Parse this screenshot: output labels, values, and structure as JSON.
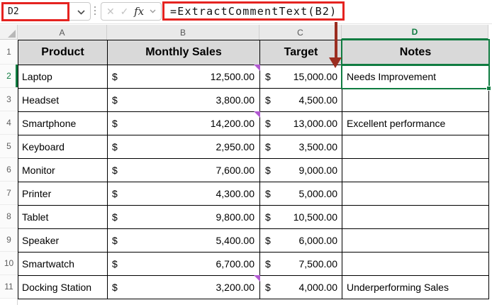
{
  "name_box": {
    "value": "D2"
  },
  "formula_bar": {
    "formula": "=ExtractCommentText(B2)",
    "cancel": "✕",
    "enter": "✓",
    "fx": "fx"
  },
  "grid": {
    "column_headers": [
      {
        "label": "A",
        "selected": false
      },
      {
        "label": "B",
        "selected": false
      },
      {
        "label": "C",
        "selected": false
      },
      {
        "label": "D",
        "selected": true
      }
    ],
    "row_headers": [
      {
        "label": "1",
        "selected": false
      },
      {
        "label": "2",
        "selected": true
      },
      {
        "label": "3",
        "selected": false
      },
      {
        "label": "4",
        "selected": false
      },
      {
        "label": "5",
        "selected": false
      },
      {
        "label": "6",
        "selected": false
      },
      {
        "label": "7",
        "selected": false
      },
      {
        "label": "8",
        "selected": false
      },
      {
        "label": "9",
        "selected": false
      },
      {
        "label": "10",
        "selected": false
      },
      {
        "label": "11",
        "selected": false
      }
    ]
  },
  "table": {
    "currency_symbol": "$",
    "columns": [
      "Product",
      "Monthly Sales",
      "Target",
      "Notes"
    ],
    "rows": [
      {
        "row": 2,
        "product": "Laptop",
        "sales": "12,500.00",
        "target": "15,000.00",
        "notes": "Needs Improvement",
        "has_comment": true,
        "selected": true
      },
      {
        "row": 3,
        "product": "Headset",
        "sales": "3,800.00",
        "target": "4,500.00",
        "notes": "",
        "has_comment": false,
        "selected": false
      },
      {
        "row": 4,
        "product": "Smartphone",
        "sales": "14,200.00",
        "target": "13,000.00",
        "notes": "Excellent performance",
        "has_comment": true,
        "selected": false
      },
      {
        "row": 5,
        "product": "Keyboard",
        "sales": "2,950.00",
        "target": "3,500.00",
        "notes": "",
        "has_comment": false,
        "selected": false
      },
      {
        "row": 6,
        "product": "Monitor",
        "sales": "7,600.00",
        "target": "9,000.00",
        "notes": "",
        "has_comment": false,
        "selected": false
      },
      {
        "row": 7,
        "product": "Printer",
        "sales": "4,300.00",
        "target": "5,000.00",
        "notes": "",
        "has_comment": false,
        "selected": false
      },
      {
        "row": 8,
        "product": "Tablet",
        "sales": "9,800.00",
        "target": "10,500.00",
        "notes": "",
        "has_comment": false,
        "selected": false
      },
      {
        "row": 9,
        "product": "Speaker",
        "sales": "5,400.00",
        "target": "6,000.00",
        "notes": "",
        "has_comment": false,
        "selected": false
      },
      {
        "row": 10,
        "product": "Smartwatch",
        "sales": "6,700.00",
        "target": "7,500.00",
        "notes": "",
        "has_comment": false,
        "selected": false
      },
      {
        "row": 11,
        "product": "Docking Station",
        "sales": "3,200.00",
        "target": "4,000.00",
        "notes": "Underperforming Sales",
        "has_comment": true,
        "selected": false
      }
    ]
  },
  "colors": {
    "excel_green": "#107c41",
    "annotation_red": "#e52320",
    "arrow_red": "#9b2d20",
    "comment_purple": "#b159d1"
  }
}
